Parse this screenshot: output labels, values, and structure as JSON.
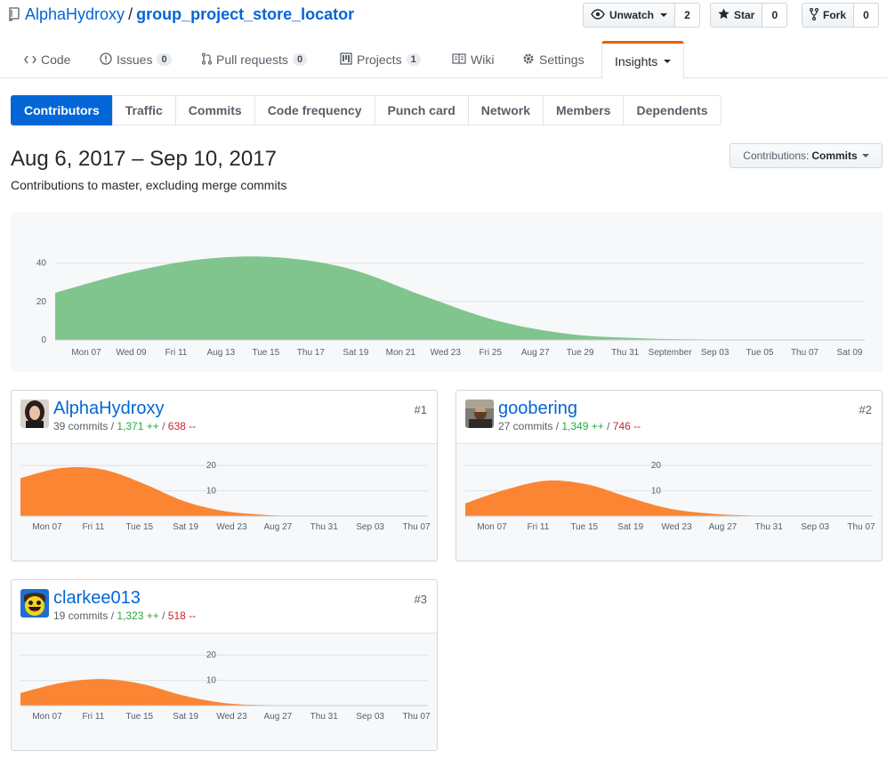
{
  "repo": {
    "owner": "AlphaHydroxy",
    "separator": "/",
    "name": "group_project_store_locator"
  },
  "social": {
    "watch": {
      "label": "Unwatch",
      "count": "2"
    },
    "star": {
      "label": "Star",
      "count": "0"
    },
    "fork": {
      "label": "Fork",
      "count": "0"
    }
  },
  "tabs": {
    "code": "Code",
    "issues": {
      "label": "Issues",
      "count": "0"
    },
    "pulls": {
      "label": "Pull requests",
      "count": "0"
    },
    "projects": {
      "label": "Projects",
      "count": "1"
    },
    "wiki": "Wiki",
    "settings": "Settings",
    "insights": "Insights"
  },
  "subnav": [
    "Contributors",
    "Traffic",
    "Commits",
    "Code frequency",
    "Punch card",
    "Network",
    "Members",
    "Dependents"
  ],
  "date_range": "Aug 6, 2017 – Sep 10, 2017",
  "date_subtitle": "Contributions to master, excluding merge commits",
  "contributions_select": {
    "prefix": "Contributions:",
    "value": "Commits"
  },
  "colors": {
    "accent": "#0366d6",
    "main_area": "#7fc58d",
    "contrib_area": "#fb8532",
    "additions": "#28a745",
    "deletions": "#cb2431",
    "insights_tab": "#e36209"
  },
  "chart_data": [
    {
      "type": "area",
      "title": "",
      "x": [
        "Aug 6",
        "Aug 9",
        "Aug 12",
        "Aug 15",
        "Aug 18",
        "Aug 21",
        "Aug 24",
        "Aug 27",
        "Aug 30",
        "Sep 2",
        "Sep 5",
        "Sep 9"
      ],
      "series": [
        {
          "values": [
            24.5,
            35,
            42,
            43,
            37,
            23,
            10,
            3,
            0.8,
            0.2,
            0,
            0
          ]
        }
      ],
      "x_tick_labels": [
        "Mon 07",
        "Wed 09",
        "Fri 11",
        "Aug 13",
        "Tue 15",
        "Thu 17",
        "Sat 19",
        "Mon 21",
        "Wed 23",
        "Fri 25",
        "Aug 27",
        "Tue 29",
        "Thu 31",
        "September",
        "Sep 03",
        "Tue 05",
        "Thu 07",
        "Sat 09"
      ],
      "y_ticks": [
        0,
        20,
        40
      ],
      "ylim": [
        0,
        50
      ],
      "grid": true
    },
    {
      "type": "area",
      "title": "AlphaHydroxy",
      "series": [
        {
          "values": [
            15,
            19,
            18.5,
            13,
            6,
            2,
            0.5,
            0,
            0,
            0,
            0
          ]
        }
      ],
      "x_tick_labels": [
        "Mon 07",
        "Fri 11",
        "Tue 15",
        "Sat 19",
        "Wed 23",
        "Aug 27",
        "Thu 31",
        "Sep 03",
        "Thu 07"
      ],
      "y_ticks": [
        10,
        20
      ],
      "ylim": [
        0,
        25
      ],
      "grid": true
    },
    {
      "type": "area",
      "title": "goobering",
      "series": [
        {
          "values": [
            5,
            10.5,
            14,
            12.5,
            7.5,
            3,
            1,
            0.2,
            0,
            0,
            0
          ]
        }
      ],
      "x_tick_labels": [
        "Mon 07",
        "Fri 11",
        "Tue 15",
        "Sat 19",
        "Wed 23",
        "Aug 27",
        "Thu 31",
        "Sep 03",
        "Thu 07"
      ],
      "y_ticks": [
        10,
        20
      ],
      "ylim": [
        0,
        25
      ],
      "grid": true
    },
    {
      "type": "area",
      "title": "clarkee013",
      "series": [
        {
          "values": [
            5,
            9,
            10.5,
            8.5,
            4,
            1,
            0.2,
            0,
            0,
            0,
            0
          ]
        }
      ],
      "x_tick_labels": [
        "Mon 07",
        "Fri 11",
        "Tue 15",
        "Sat 19",
        "Wed 23",
        "Aug 27",
        "Thu 31",
        "Sep 03",
        "Thu 07"
      ],
      "y_ticks": [
        10,
        20
      ],
      "ylim": [
        0,
        25
      ],
      "grid": true
    }
  ],
  "contributors": [
    {
      "login": "AlphaHydroxy",
      "rank": "#1",
      "commits": "39 commits",
      "additions": "1,371 ++",
      "deletions": "638 --"
    },
    {
      "login": "goobering",
      "rank": "#2",
      "commits": "27 commits",
      "additions": "1,349 ++",
      "deletions": "746 --"
    },
    {
      "login": "clarkee013",
      "rank": "#3",
      "commits": "19 commits",
      "additions": "1,323 ++",
      "deletions": "518 --"
    }
  ]
}
